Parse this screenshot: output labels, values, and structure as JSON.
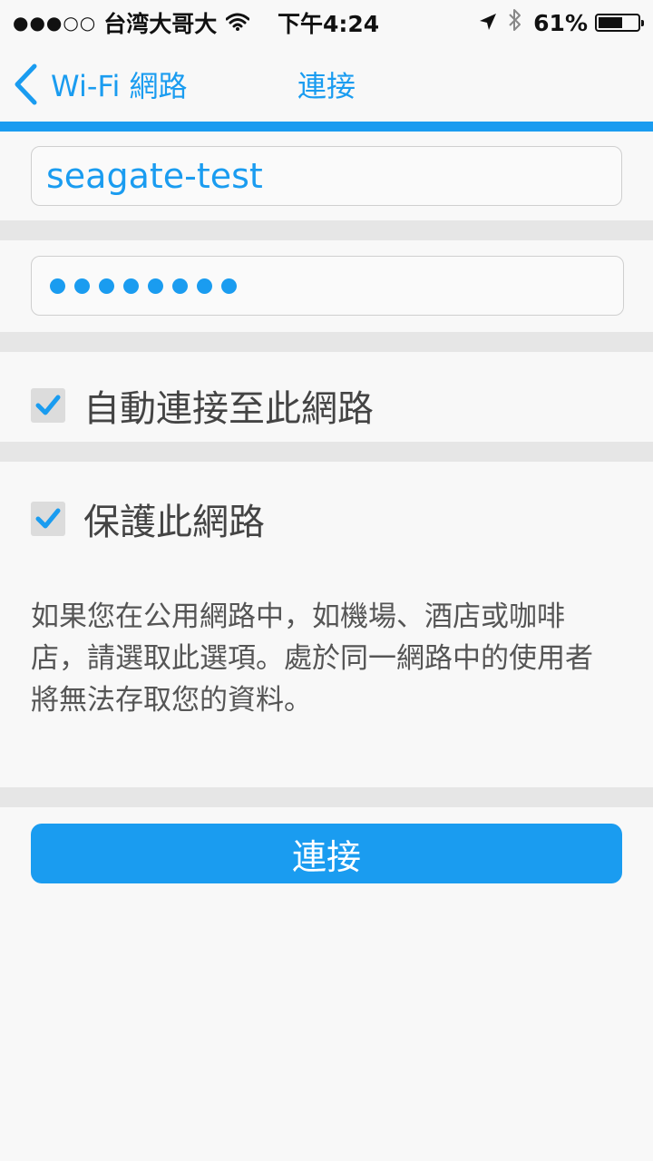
{
  "status_bar": {
    "signal": "●●●○○",
    "carrier": "台湾大哥大",
    "time": "下午4:24",
    "battery": "61%",
    "battery_level": 0.61
  },
  "nav": {
    "back_label": "Wi-Fi 網路",
    "title": "連接"
  },
  "form": {
    "ssid_value": "seagate-test",
    "password_masked_length": 8,
    "auto_connect_label": "自動連接至此網路",
    "auto_connect_checked": true,
    "protect_label": "保護此網路",
    "protect_checked": true,
    "protect_description": "如果您在公用網路中，如機場、酒店或咖啡店，請選取此選項。處於同一網路中的使用者將無法存取您的資料。",
    "connect_button": "連接"
  },
  "colors": {
    "accent": "#1a9cf0",
    "background": "#f8f8f8",
    "separator": "#e6e6e6"
  },
  "icons": [
    "wifi-icon",
    "location-arrow-icon",
    "bluetooth-icon",
    "battery-icon",
    "chevron-left-icon",
    "checkmark-icon"
  ]
}
